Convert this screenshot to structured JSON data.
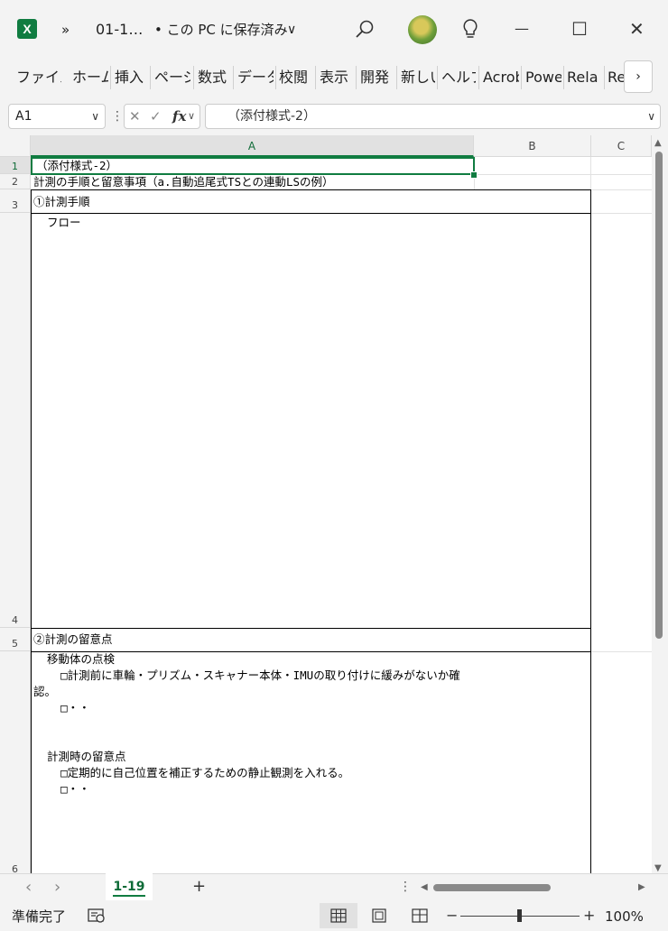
{
  "title_bar": {
    "app_letter": "X",
    "overflow_label": "»",
    "doc_name": "01-1…",
    "save_status": "• この PC に保存済み",
    "save_chevron": "∨",
    "search_icon": "search-icon",
    "idea_icon": "lightbulb-icon",
    "minimize": "—",
    "maximize": "☐",
    "close": "✕"
  },
  "ribbon": {
    "tabs": [
      "ファイル",
      "ホーム",
      "挿入",
      "ページ",
      "数式",
      "データ",
      "校閲",
      "表示",
      "開発",
      "新しい",
      "ヘルプ",
      "Acrobat",
      "Power",
      "Rela",
      "Re"
    ],
    "more": "›"
  },
  "formula_bar": {
    "name_box": "A1",
    "dropdown": "∨",
    "separator": "⋮",
    "cancel": "✕",
    "enter": "✓",
    "fx": "fx",
    "fx_dd": "∨",
    "value": "（添付様式-2）"
  },
  "columns": [
    "A",
    "B",
    "C"
  ],
  "rows": [
    "1",
    "2",
    "3",
    "4",
    "5",
    "6"
  ],
  "cells": {
    "r1": "（添付様式-2）",
    "r2": "計測の手順と留意事項（a.自動追尾式TSとの連動LSの例）",
    "r3": "①計測手順",
    "r3_flow": "  フロー",
    "r5": "②計測の留意点",
    "r6_lines": [
      "  移動体の点検",
      "    □計測前に車輪・プリズム・スキャナー本体・IMUの取り付けに緩みがないか確",
      "認。",
      "    □・・",
      "",
      "",
      "  計測時の留意点",
      "    □定期的に自己位置を補正するための静止観測を入れる。",
      "    □・・"
    ]
  },
  "sheet_tabs": {
    "prev": "‹",
    "next": "›",
    "active": "1-19",
    "add": "+",
    "options": "⋮"
  },
  "status_bar": {
    "ready": "準備完了",
    "zoom_minus": "−",
    "zoom_plus": "+",
    "zoom": "100%",
    "zoom_level": 0.5
  },
  "colors": {
    "accent": "#107c41"
  }
}
